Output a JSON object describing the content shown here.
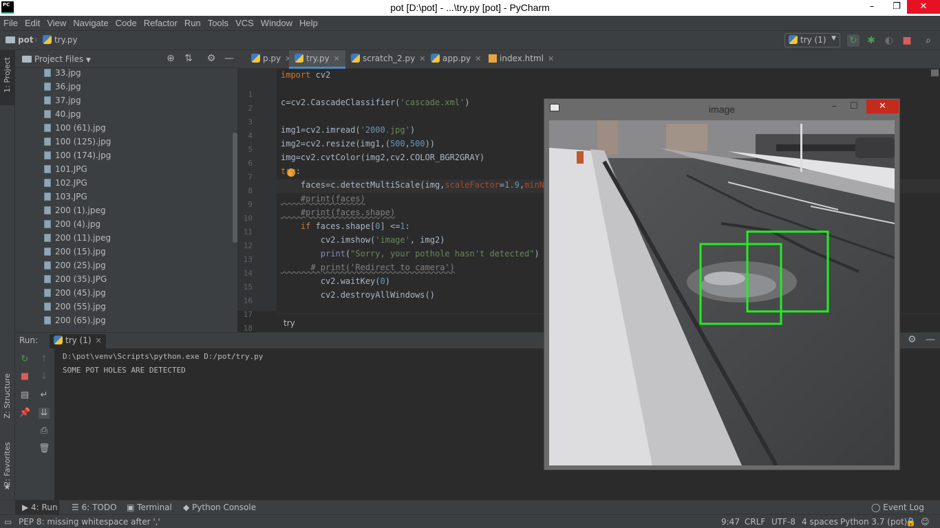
{
  "window": {
    "title": "pot [D:\\pot] - ...\\try.py [pot] - PyCharm",
    "minimize": "–",
    "maximize": "❐",
    "close": "✕"
  },
  "menu": [
    "File",
    "Edit",
    "View",
    "Navigate",
    "Code",
    "Refactor",
    "Run",
    "Tools",
    "VCS",
    "Window",
    "Help"
  ],
  "breadcrumb": {
    "project": "pot",
    "file": "try.py"
  },
  "run_config": "try (1)",
  "left_tool_tabs": {
    "project": "1: Project",
    "structure": "Z: Structure",
    "favorites": "2: Favorites"
  },
  "project_panel": {
    "title": "Project Files",
    "files": [
      "33.jpg",
      "36.jpg",
      "37.jpg",
      "40.jpg",
      "100 (61).jpg",
      "100 (125).jpg",
      "100 (174).jpg",
      "101.JPG",
      "102.JPG",
      "103.JPG",
      "200 (1).jpeg",
      "200 (4).jpg",
      "200 (11).jpeg",
      "200 (15).jpg",
      "200 (25).jpg",
      "200 (35).JPG",
      "200 (45).jpg",
      "200 (55).jpg",
      "200 (65).jpg"
    ]
  },
  "tabs": [
    {
      "label": "p.py",
      "active": false
    },
    {
      "label": "try.py",
      "active": true
    },
    {
      "label": "scratch_2.py",
      "active": false
    },
    {
      "label": "app.py",
      "active": false
    },
    {
      "label": "index.html",
      "active": false
    }
  ],
  "editor": {
    "line_numbers": [
      "1",
      "2",
      "3",
      "4",
      "5",
      "6",
      "7",
      "8",
      "9",
      "10",
      "11",
      "12",
      "13",
      "14",
      "15",
      "16",
      "17",
      "18"
    ],
    "lines": [
      "import cv2",
      "",
      "c=cv2.CascadeClassifier('cascade.xml')",
      "",
      "img1=cv2.imread('2000.jpg')",
      "img2=cv2.resize(img1,(500,500))",
      "img=cv2.cvtColor(img2,cv2.COLOR_BGR2GRAY)",
      "try:",
      "    faces=c.detectMultiScale(img,scaleFactor=1.9,minNeigh",
      "    #print(faces)",
      "    #print(faces.shape)",
      "    if faces.shape[0] <=1:",
      "        cv2.imshow('image', img2)",
      "        print(\"Sorry, your pothole hasn't detected\")",
      "      # print('Redirect to camera')",
      "        cv2.waitKey(0)",
      "        cv2.destroyAllWindows()",
      ""
    ],
    "crumb": "try"
  },
  "run": {
    "label": "Run:",
    "config": "try (1)",
    "output": [
      "D:\\pot\\venv\\Scripts\\python.exe D:/pot/try.py",
      "SOME POT HOLES ARE DETECTED"
    ]
  },
  "bottom_tabs": {
    "run": "4: Run",
    "todo": "6: TODO",
    "terminal": "Terminal",
    "console": "Python Console",
    "event_log": "Event Log"
  },
  "status": {
    "message": "PEP 8: missing whitespace after ','",
    "position": "9:47",
    "line_sep": "CRLF",
    "encoding": "UTF-8",
    "indent": "4 spaces",
    "interpreter": "Python 3.7 (pot)"
  },
  "cv_window": {
    "title": "image",
    "close": "✕",
    "detection_box_color": "#22ee22"
  }
}
